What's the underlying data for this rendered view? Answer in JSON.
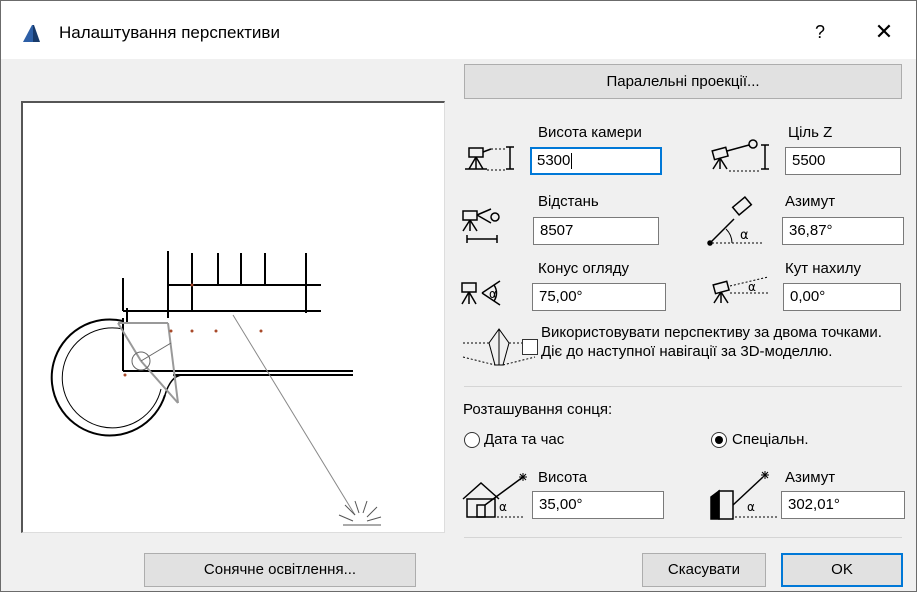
{
  "dialog": {
    "title": "Налаштування перспективи",
    "help": "?",
    "close": "✕"
  },
  "buttons": {
    "parallel": "Паралельні проекції...",
    "sun_lighting": "Сонячне освітлення...",
    "cancel": "Скасувати",
    "ok": "OK"
  },
  "camera": {
    "camera_height": {
      "label": "Висота камери",
      "value": "5300"
    },
    "target_z": {
      "label": "Ціль Z",
      "value": "5500"
    },
    "distance": {
      "label": "Відстань",
      "value": "8507"
    },
    "azimuth": {
      "label": "Азимут",
      "value": "36,87°"
    },
    "view_cone": {
      "label": "Конус огляду",
      "value": "75,00°"
    },
    "tilt": {
      "label": "Кут нахилу",
      "value": "0,00°"
    }
  },
  "two_point": {
    "text": "Використовувати перспективу за двома точками. Діє до наступної навігації за 3D-моделлю.",
    "checked": false
  },
  "sun": {
    "section_label": "Розташування сонця:",
    "option_date": "Дата та час",
    "option_custom": "Спеціальн.",
    "selected": "custom",
    "altitude": {
      "label": "Висота",
      "value": "35,00°"
    },
    "azimuth": {
      "label": "Азимут",
      "value": "302,01°"
    }
  },
  "colors": {
    "accent": "#0078d7",
    "button": "#e1e1e1",
    "background": "#f0f0f0"
  }
}
